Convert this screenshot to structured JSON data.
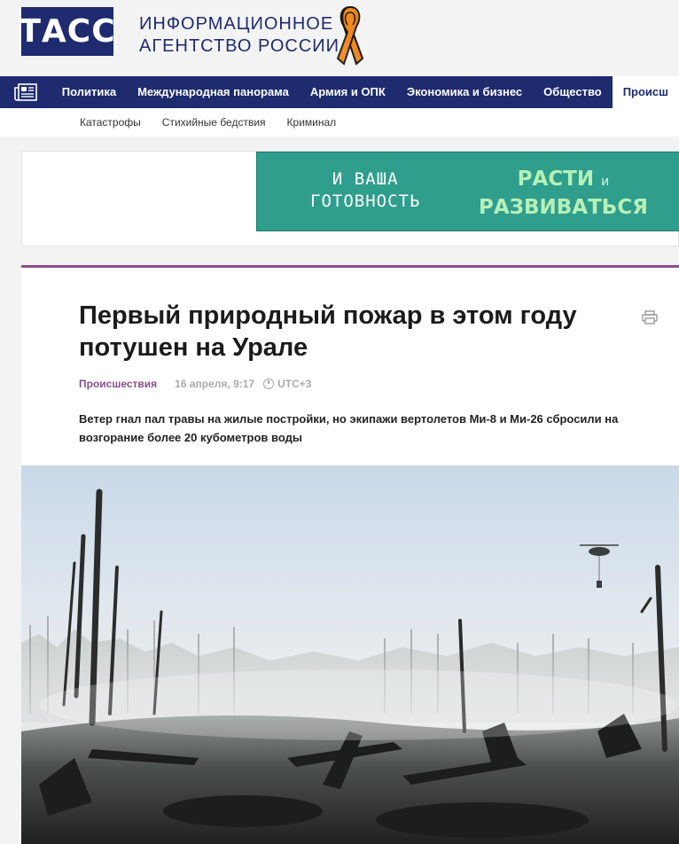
{
  "header": {
    "logo_text": "ТАСС",
    "agency_line1": "ИНФОРМАЦИОННОЕ",
    "agency_line2": "АГЕНТСТВО РОССИИ"
  },
  "nav": {
    "icon": "newspaper-icon",
    "items": [
      "Политика",
      "Международная панорама",
      "Армия и ОПК",
      "Экономика и бизнес",
      "Общество",
      "Происш"
    ]
  },
  "subnav": {
    "items": [
      "Катастрофы",
      "Стихийные бедствия",
      "Криминал"
    ]
  },
  "ad": {
    "left_line1": "И ВАША",
    "left_line2": "ГОТОВНОСТЬ",
    "right_word1": "РАСТИ",
    "right_conj": "и",
    "right_word2": "РАЗВИВАТЬСЯ"
  },
  "article": {
    "title": "Первый природный пожар в этом году потушен на Урале",
    "rubric": "Происшествия",
    "date": "16 апреля, 9:17",
    "timezone": "UTC+3",
    "lead": "Ветер гнал пал травы на жилые постройки, но экипажи вертолетов Ми-8 и Ми-26 сбросили на возгорание более 20 кубометров воды"
  },
  "colors": {
    "brand": "#1e2b6f",
    "rubric": "#8a4f88",
    "ad_bg": "#2f9e8c"
  }
}
